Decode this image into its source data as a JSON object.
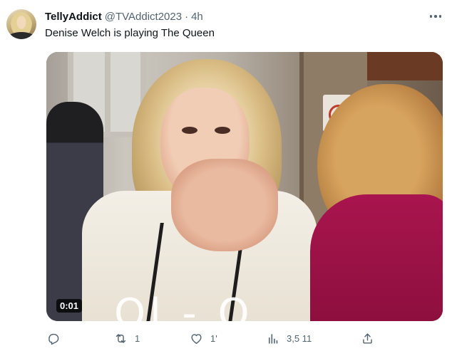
{
  "tweet": {
    "display_name": "TellyAddict",
    "handle": "@TVAddict2023",
    "separator": "·",
    "time": "4h",
    "text": "Denise Welch is playing The Queen"
  },
  "media": {
    "video_time": "0:01",
    "caption_fragment": "Ol  -  O"
  },
  "actions": {
    "reply": {
      "icon": "reply-icon",
      "count": ""
    },
    "retweet": {
      "icon": "retweet-icon",
      "count": "1"
    },
    "like": {
      "icon": "heart-icon",
      "count": "1'"
    },
    "views": {
      "icon": "views-icon",
      "count": "3,5 11"
    },
    "share": {
      "icon": "share-icon",
      "count": ""
    }
  },
  "colors": {
    "text_primary": "#0f1419",
    "text_secondary": "#536471",
    "background": "#ffffff"
  }
}
